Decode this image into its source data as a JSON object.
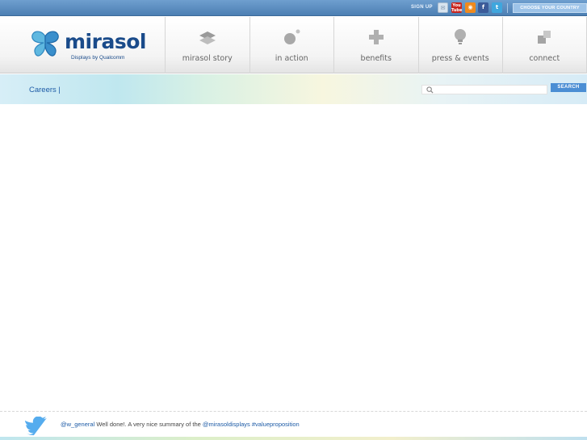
{
  "topbar": {
    "signup_label": "SIGN UP",
    "social": [
      {
        "name": "email-icon",
        "glyph": "✉"
      },
      {
        "name": "youtube-icon",
        "glyph": "You Tube"
      },
      {
        "name": "rss-icon",
        "glyph": "◉"
      },
      {
        "name": "facebook-icon",
        "glyph": "f"
      },
      {
        "name": "twitter-icon",
        "glyph": "t"
      }
    ],
    "country_label": "CHOOSE YOUR COUNTRY"
  },
  "header": {
    "logo_word": "mirasol",
    "logo_tagline": "Displays by Qualcomm",
    "nav": [
      {
        "label": "mirasol story",
        "icon": "layers-icon"
      },
      {
        "label": "in action",
        "icon": "bubbles-icon"
      },
      {
        "label": "benefits",
        "icon": "plus-icon"
      },
      {
        "label": "press & events",
        "icon": "lightbulb-icon"
      },
      {
        "label": "connect",
        "icon": "connect-squares-icon"
      }
    ]
  },
  "subbar": {
    "careers_label": "Careers |",
    "search_placeholder": "",
    "search_button": "SEARCH"
  },
  "footer": {
    "tweet_handle": "@w_general",
    "tweet_text_1": " Well done!. A very nice summary of the ",
    "tweet_mention": "@mirasoldisplays",
    "tweet_text_2": " ",
    "tweet_hashtag": "#valueproposition"
  },
  "colors": {
    "topbar": "#5a8cc0",
    "brand_blue": "#1a4b8a",
    "link_blue": "#1d5ba6",
    "search_button": "#4b8ed4"
  }
}
